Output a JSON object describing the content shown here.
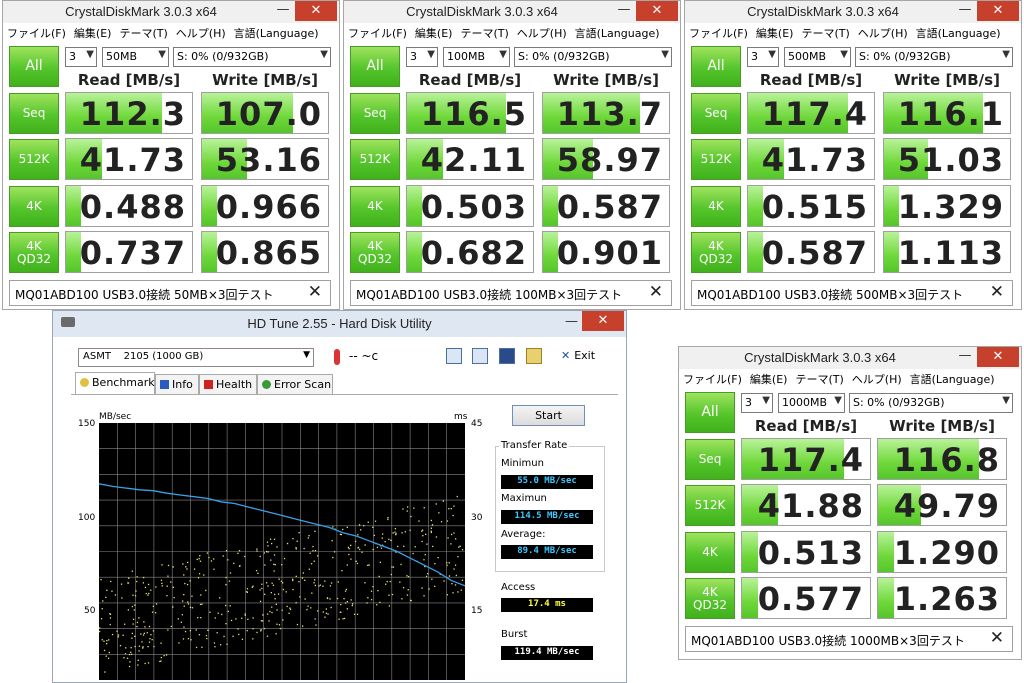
{
  "cdm_windows": [
    {
      "title": "CrystalDiskMark 3.0.3 x64",
      "menu": [
        "ファイル(F)",
        "編集(E)",
        "テーマ(T)",
        "ヘルプ(H)",
        "言語(Language)"
      ],
      "count": "3",
      "size": "50MB",
      "drive": "S: 0% (0/932GB)",
      "all_label": "All",
      "read_header": "Read [MB/s]",
      "write_header": "Write [MB/s]",
      "rows": [
        {
          "label": "Seq",
          "read": "112.3",
          "write": "107.0"
        },
        {
          "label": "512K",
          "read": "41.73",
          "write": "53.16"
        },
        {
          "label": "4K",
          "read": "0.488",
          "write": "0.966"
        },
        {
          "label": "4K\nQD32",
          "read": "0.737",
          "write": "0.865"
        }
      ],
      "comment": "MQ01ABD100 USB3.0接続 50MB×3回テスト"
    },
    {
      "title": "CrystalDiskMark 3.0.3 x64",
      "menu": [
        "ファイル(F)",
        "編集(E)",
        "テーマ(T)",
        "ヘルプ(H)",
        "言語(Language)"
      ],
      "count": "3",
      "size": "100MB",
      "drive": "S: 0% (0/932GB)",
      "all_label": "All",
      "read_header": "Read [MB/s]",
      "write_header": "Write [MB/s]",
      "rows": [
        {
          "label": "Seq",
          "read": "116.5",
          "write": "113.7"
        },
        {
          "label": "512K",
          "read": "42.11",
          "write": "58.97"
        },
        {
          "label": "4K",
          "read": "0.503",
          "write": "0.587"
        },
        {
          "label": "4K\nQD32",
          "read": "0.682",
          "write": "0.901"
        }
      ],
      "comment": "MQ01ABD100 USB3.0接続 100MB×3回テスト"
    },
    {
      "title": "CrystalDiskMark 3.0.3 x64",
      "menu": [
        "ファイル(F)",
        "編集(E)",
        "テーマ(T)",
        "ヘルプ(H)",
        "言語(Language)"
      ],
      "count": "3",
      "size": "500MB",
      "drive": "S: 0% (0/932GB)",
      "all_label": "All",
      "read_header": "Read [MB/s]",
      "write_header": "Write [MB/s]",
      "rows": [
        {
          "label": "Seq",
          "read": "117.4",
          "write": "116.1"
        },
        {
          "label": "512K",
          "read": "41.73",
          "write": "51.03"
        },
        {
          "label": "4K",
          "read": "0.515",
          "write": "1.329"
        },
        {
          "label": "4K\nQD32",
          "read": "0.587",
          "write": "1.113"
        }
      ],
      "comment": "MQ01ABD100 USB3.0接続 500MB×3回テスト"
    },
    {
      "title": "CrystalDiskMark 3.0.3 x64",
      "menu": [
        "ファイル(F)",
        "編集(E)",
        "テーマ(T)",
        "ヘルプ(H)",
        "言語(Language)"
      ],
      "count": "3",
      "size": "1000MB",
      "drive": "S: 0% (0/932GB)",
      "all_label": "All",
      "read_header": "Read [MB/s]",
      "write_header": "Write [MB/s]",
      "rows": [
        {
          "label": "Seq",
          "read": "117.4",
          "write": "116.8"
        },
        {
          "label": "512K",
          "read": "41.88",
          "write": "49.79"
        },
        {
          "label": "4K",
          "read": "0.513",
          "write": "1.290"
        },
        {
          "label": "4K\nQD32",
          "read": "0.577",
          "write": "1.263"
        }
      ],
      "comment": "MQ01ABD100 USB3.0接続 1000MB×3回テスト"
    }
  ],
  "hdtune": {
    "title": "HD Tune 2.55 - Hard Disk Utility",
    "drive": "ASMT    2105 (1000 GB)",
    "temperature": "-- ~c",
    "exit_label": "Exit",
    "tabs": [
      "Benchmark",
      "Info",
      "Health",
      "Error Scan"
    ],
    "start_label": "Start",
    "transfer_rate_label": "Transfer Rate",
    "minimum_label": "Minimun",
    "minimum_value": "55.0 MB/sec",
    "maximum_label": "Maximun",
    "maximum_value": "114.5 MB/sec",
    "average_label": "Average:",
    "average_value": "89.4 MB/sec",
    "access_label": "Access",
    "access_value": "17.4 ms",
    "burst_label": "Burst",
    "burst_value": "119.4 MB/sec",
    "left_unit": "MB/sec",
    "right_unit": "ms",
    "left_ticks": [
      "150",
      "100",
      "50"
    ],
    "right_ticks": [
      "45",
      "30",
      "15"
    ],
    "colors": {
      "transfer_line": "#3aa0e8",
      "access_dots": "#e8e070",
      "value_text_blue": "#3cc8ff",
      "value_text_yellow": "#ffff40"
    }
  },
  "chart_data": {
    "type": "line",
    "ylim": [
      0,
      150
    ],
    "y2lim": [
      0,
      45
    ],
    "series": [
      {
        "values": [
          114.5,
          113,
          112,
          111,
          110.5,
          109,
          108,
          107,
          106,
          104,
          103,
          101,
          99,
          97,
          95,
          93,
          91,
          89,
          86,
          84,
          81,
          78,
          75,
          71,
          67,
          63,
          58,
          55
        ]
      }
    ]
  }
}
